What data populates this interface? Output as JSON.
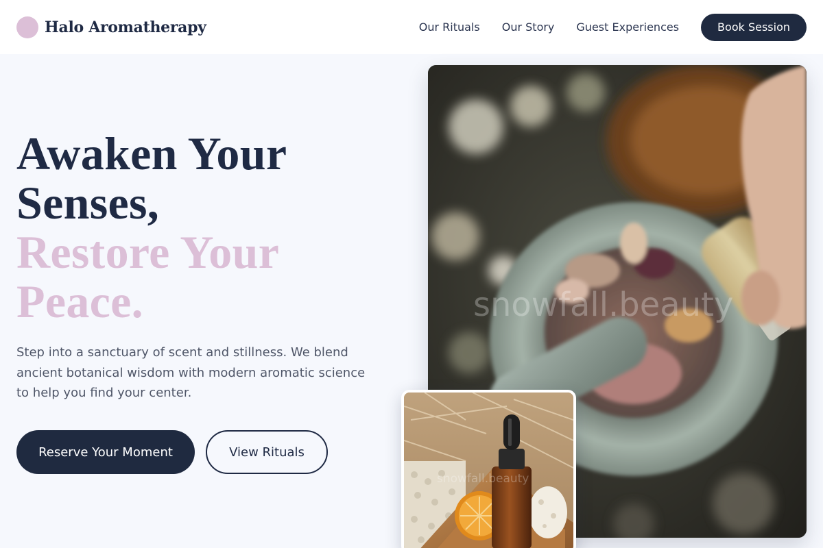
{
  "brand": {
    "name": "Halo Aromatherapy",
    "logo_icon": "circle-logo-icon",
    "logo_color": "#dcbfd7"
  },
  "nav": {
    "links": [
      "Our Rituals",
      "Our Story",
      "Guest Experiences"
    ],
    "cta_label": "Book Session"
  },
  "hero": {
    "title_lines": [
      "Awaken Your",
      "Senses,"
    ],
    "accent_lines": [
      "Restore Your",
      "Peace."
    ],
    "description": "Step into a sanctuary of scent and stillness. We blend ancient botanical wisdom with modern aromatic science to help you find your center.",
    "primary_button": "Reserve Your Moment",
    "secondary_button": "View Rituals"
  },
  "images": {
    "main": {
      "subject": "mortar-and-pestle-oil-pour-photo",
      "watermark": "snowfall.beauty"
    },
    "secondary": {
      "subject": "amber-dropper-bottle-photo",
      "watermark": "snowfall.beauty"
    }
  },
  "colors": {
    "navy": "#1f2a44",
    "accent_pink": "#dcbfd7",
    "background": "#f6f8fd"
  }
}
